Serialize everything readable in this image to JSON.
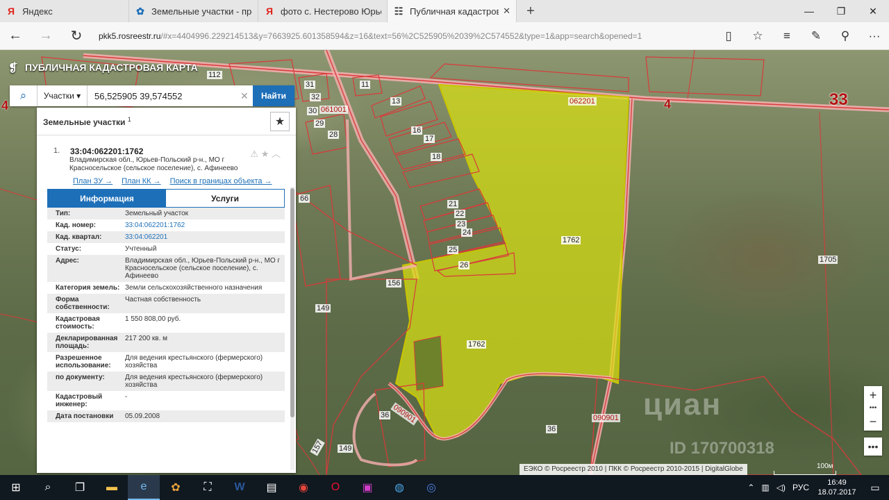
{
  "browser": {
    "tabs": [
      {
        "favicon": "Я",
        "favicon_color": "#e0221a",
        "title": "Яндекс"
      },
      {
        "favicon": "✿",
        "favicon_color": "#1d6fb8",
        "title": "Земельные участки - прод"
      },
      {
        "favicon": "Я",
        "favicon_color": "#e0221a",
        "title": "фото с. Нестерово Юрьев-"
      },
      {
        "favicon": "☷",
        "favicon_color": "#333333",
        "title": "Публичная кадастрова"
      }
    ],
    "url_host": "pkk5.rosreestr.ru",
    "url_rest": "/#x=4404996.229214513&y=7663925.601358594&z=16&text=56%2C525905%2039%2C574552&type=1&app=search&opened=1"
  },
  "app": {
    "title": "ПУБЛИЧНАЯ КАДАСТРОВАЯ КАРТА",
    "search": {
      "type_label": "Участки",
      "value": "56,525905 39,574552",
      "button": "Найти"
    }
  },
  "panel": {
    "heading": "Земельные участки",
    "heading_count": "1",
    "result": {
      "index": "1.",
      "cadnum": "33:04:062201:1762",
      "address": "Владимирская обл., Юрьев-Польский р-н., МО г Красносельское (сельское поселение), с. Афинеево",
      "links": [
        "План ЗУ →",
        "План КК →",
        "Поиск в границах объекта →"
      ],
      "tabs": [
        "Информация",
        "Услуги"
      ],
      "attributes": [
        {
          "k": "Тип:",
          "v": "Земельный участок"
        },
        {
          "k": "Кад. номер:",
          "v": "33:04:062201:1762",
          "link": true
        },
        {
          "k": "Кад. квартал:",
          "v": "33:04:062201",
          "link": true
        },
        {
          "k": "Статус:",
          "v": "Учтенный"
        },
        {
          "k": "Адрес:",
          "v": "Владимирская обл., Юрьев-Польский р-н., МО г Красносельское (сельское поселение), с. Афинеево"
        },
        {
          "k": "Категория земель:",
          "v": "Земли сельскохозяйственного назначения"
        },
        {
          "k": "Форма собственности:",
          "v": "Частная собственность"
        },
        {
          "k": "Кадастровая стоимость:",
          "v": "1 550 808,00 руб."
        },
        {
          "k": "Декларированная площадь:",
          "v": "217 200 кв. м"
        },
        {
          "k": "Разрешенное использование:",
          "v": "Для ведения крестьянского (фермерского) хозяйства"
        },
        {
          "k": "по документу:",
          "v": "Для ведения крестьянского (фермерского) хозяйства"
        },
        {
          "k": "Кадастровый инженер:",
          "v": "-"
        },
        {
          "k": "Дата постановки",
          "v": "05.09.2008"
        }
      ]
    }
  },
  "map": {
    "labels": [
      "112",
      "31",
      "32",
      "30",
      "29",
      "28",
      "061001",
      "11",
      "13",
      "16",
      "17",
      "18",
      "21",
      "22",
      "23",
      "24",
      "25",
      "26",
      "66",
      "062201",
      "1762",
      "1762",
      "1705",
      "156",
      "149",
      "36",
      "090901",
      "090901",
      "36",
      "157",
      "149",
      "4",
      "33",
      "4"
    ],
    "attribution": "ЕЭКО © Росреестр 2010 | ПКК © Росреестр 2010-2015 | DigitalGlobe",
    "scale": "100м",
    "watermark": "циан",
    "watermark_id": "ID 170700318"
  },
  "taskbar": {
    "lang": "РУС",
    "time": "16:49",
    "date": "18.07.2017"
  }
}
